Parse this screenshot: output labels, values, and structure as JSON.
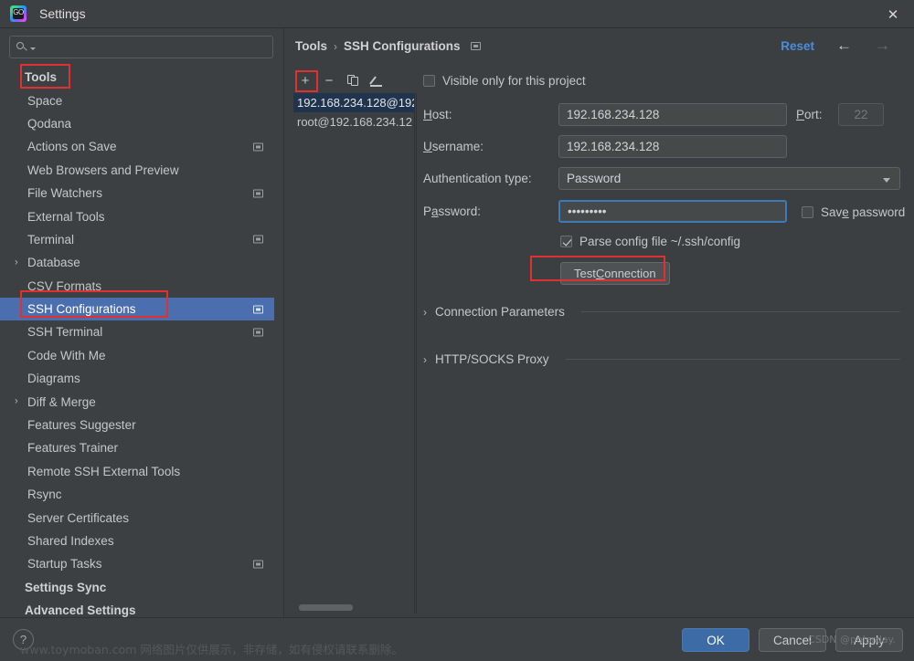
{
  "window": {
    "title": "Settings",
    "app_icon": "goland-icon",
    "close_label": "✕"
  },
  "sidebar": {
    "search": {
      "placeholder": "",
      "value": "",
      "icon": "search-icon"
    },
    "items": [
      {
        "label": "Tools",
        "top_level": true,
        "expander": "",
        "project_icon": false,
        "selected": false
      },
      {
        "label": "Space",
        "top_level": false,
        "expander": "",
        "project_icon": false,
        "selected": false
      },
      {
        "label": "Qodana",
        "top_level": false,
        "expander": "",
        "project_icon": false,
        "selected": false
      },
      {
        "label": "Actions on Save",
        "top_level": false,
        "expander": "",
        "project_icon": true,
        "selected": false
      },
      {
        "label": "Web Browsers and Preview",
        "top_level": false,
        "expander": "",
        "project_icon": false,
        "selected": false
      },
      {
        "label": "File Watchers",
        "top_level": false,
        "expander": "",
        "project_icon": true,
        "selected": false
      },
      {
        "label": "External Tools",
        "top_level": false,
        "expander": "",
        "project_icon": false,
        "selected": false
      },
      {
        "label": "Terminal",
        "top_level": false,
        "expander": "",
        "project_icon": true,
        "selected": false
      },
      {
        "label": "Database",
        "top_level": false,
        "expander": "›",
        "project_icon": false,
        "selected": false
      },
      {
        "label": "CSV Formats",
        "top_level": false,
        "expander": "",
        "project_icon": false,
        "selected": false
      },
      {
        "label": "SSH Configurations",
        "top_level": false,
        "expander": "",
        "project_icon": true,
        "selected": true
      },
      {
        "label": "SSH Terminal",
        "top_level": false,
        "expander": "",
        "project_icon": true,
        "selected": false
      },
      {
        "label": "Code With Me",
        "top_level": false,
        "expander": "",
        "project_icon": false,
        "selected": false
      },
      {
        "label": "Diagrams",
        "top_level": false,
        "expander": "",
        "project_icon": false,
        "selected": false
      },
      {
        "label": "Diff & Merge",
        "top_level": false,
        "expander": "›",
        "project_icon": false,
        "selected": false
      },
      {
        "label": "Features Suggester",
        "top_level": false,
        "expander": "",
        "project_icon": false,
        "selected": false
      },
      {
        "label": "Features Trainer",
        "top_level": false,
        "expander": "",
        "project_icon": false,
        "selected": false
      },
      {
        "label": "Remote SSH External Tools",
        "top_level": false,
        "expander": "",
        "project_icon": false,
        "selected": false
      },
      {
        "label": "Rsync",
        "top_level": false,
        "expander": "",
        "project_icon": false,
        "selected": false
      },
      {
        "label": "Server Certificates",
        "top_level": false,
        "expander": "",
        "project_icon": false,
        "selected": false
      },
      {
        "label": "Shared Indexes",
        "top_level": false,
        "expander": "",
        "project_icon": false,
        "selected": false
      },
      {
        "label": "Startup Tasks",
        "top_level": false,
        "expander": "",
        "project_icon": true,
        "selected": false
      },
      {
        "label": "Settings Sync",
        "top_level": true,
        "expander": "",
        "project_icon": false,
        "selected": false
      },
      {
        "label": "Advanced Settings",
        "top_level": true,
        "expander": "",
        "project_icon": false,
        "selected": false
      }
    ]
  },
  "header": {
    "breadcrumb_root": "Tools",
    "breadcrumb_sep": "›",
    "breadcrumb_current": "SSH Configurations",
    "reset_label": "Reset",
    "back_arrow": "←",
    "forward_arrow": "→"
  },
  "list_toolbar": {
    "add_label": "+",
    "remove_label": "−",
    "copy_label": "copy-icon",
    "edit_label": "pencil-icon"
  },
  "connections": [
    {
      "label": "192.168.234.128@192",
      "selected": true
    },
    {
      "label": "root@192.168.234.12",
      "selected": false
    }
  ],
  "form": {
    "visible_only_label": "Visible only for this project",
    "visible_only_checked": false,
    "host_label_pre": "H",
    "host_label_post": "ost:",
    "host_value": "192.168.234.128",
    "port_label_pre": "P",
    "port_label_post": "ort:",
    "port_placeholder": "22",
    "username_label_pre": "U",
    "username_label_post": "sername:",
    "username_value": "192.168.234.128",
    "auth_label": "Authentication type:",
    "auth_value": "Password",
    "password_label_pre": "P",
    "password_label_mid": "a",
    "password_label_post": "ssword:",
    "password_value": "•••••••••",
    "save_password_label_pre": "Sav",
    "save_password_label_mid": "e",
    "save_password_label_post": " password",
    "save_password_checked": false,
    "parse_config_label": "Parse config file ~/.ssh/config",
    "parse_config_checked": true,
    "test_connection_pre": "Test ",
    "test_connection_mid": "C",
    "test_connection_post": "onnection",
    "section_connection_params": "Connection Parameters",
    "section_http_socks_proxy": "HTTP/SOCKS Proxy",
    "chevron": "›"
  },
  "footer": {
    "help_label": "?",
    "ok_label": "OK",
    "cancel_label": "Cancel",
    "apply_label": "Apply"
  },
  "watermarks": {
    "bottom": "www.toymoban.com 网络图片仅供展示，非存储，如有侵权请联系删除。",
    "csdn": "CSDN @polarday."
  },
  "colors": {
    "accent_blue": "#4b6eaf",
    "primary_button": "#3c6ba5",
    "link_blue": "#4b8ddb",
    "annotation_red": "#e03030",
    "window_bg": "#3c3f41",
    "panel_bg": "#3c4043"
  }
}
